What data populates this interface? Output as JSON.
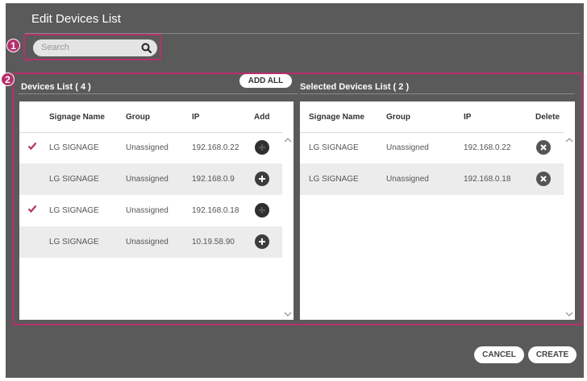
{
  "dialog": {
    "title": "Edit Devices List"
  },
  "markers": {
    "m1": "1",
    "m2": "2"
  },
  "search": {
    "placeholder": "Search",
    "icon": "search-icon"
  },
  "left_panel": {
    "title": "Devices List ( 4 )",
    "add_all_label": "ADD ALL",
    "columns": [
      "Signage Name",
      "Group",
      "IP",
      "Add"
    ],
    "rows": [
      {
        "checked": true,
        "name": "LG SIGNAGE",
        "group": "Unassigned",
        "ip": "192.168.0.22",
        "action": "add"
      },
      {
        "checked": false,
        "name": "LG SIGNAGE",
        "group": "Unassigned",
        "ip": "192.168.0.9",
        "action": "add"
      },
      {
        "checked": true,
        "name": "LG SIGNAGE",
        "group": "Unassigned",
        "ip": "192.168.0.18",
        "action": "add"
      },
      {
        "checked": false,
        "name": "LG SIGNAGE",
        "group": "Unassigned",
        "ip": "10.19.58.90",
        "action": "add"
      }
    ]
  },
  "right_panel": {
    "title": "Selected Devices List ( 2 )",
    "columns": [
      "Signage Name",
      "Group",
      "IP",
      "Delete"
    ],
    "rows": [
      {
        "name": "LG SIGNAGE",
        "group": "Unassigned",
        "ip": "192.168.0.22",
        "action": "delete"
      },
      {
        "name": "LG SIGNAGE",
        "group": "Unassigned",
        "ip": "192.168.0.18",
        "action": "delete"
      }
    ]
  },
  "footer": {
    "cancel_label": "CANCEL",
    "create_label": "CREATE"
  },
  "colors": {
    "accent": "#b5316c",
    "dialog_bg": "#5a5a5a",
    "check": "#b5316c"
  }
}
